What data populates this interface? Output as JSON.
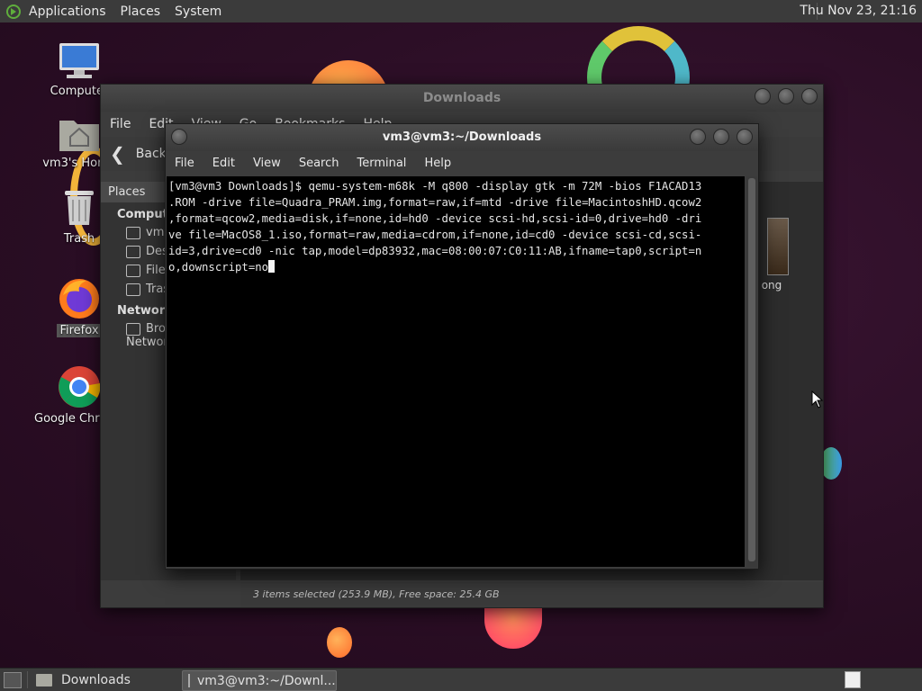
{
  "top_panel": {
    "menus": [
      "Applications",
      "Places",
      "System"
    ],
    "clock": "Thu Nov 23, 21:16"
  },
  "desktop_icons": [
    {
      "label": "Computer",
      "icon": "computer-icon"
    },
    {
      "label": "vm3's Home",
      "icon": "home-folder-icon"
    },
    {
      "label": "Trash",
      "icon": "trash-icon"
    },
    {
      "label": "Firefox",
      "icon": "firefox-icon"
    },
    {
      "label": "Google Chrome",
      "icon": "chrome-icon"
    }
  ],
  "file_manager": {
    "title": "Downloads",
    "menus": [
      "File",
      "Edit",
      "View",
      "Go",
      "Bookmarks",
      "Help"
    ],
    "back_label": "Back",
    "sidebar_header": "Places",
    "sections": {
      "computer": "Computer",
      "network": "Network"
    },
    "computer_items": [
      "vm3",
      "Desktop",
      "File System",
      "Trash"
    ],
    "network_items": [
      "Browse Network"
    ],
    "file_partial_label": "ong",
    "status": "3 items selected (253.9 MB), Free space: 25.4 GB"
  },
  "terminal": {
    "title": "vm3@vm3:~/Downloads",
    "menus": [
      "File",
      "Edit",
      "View",
      "Search",
      "Terminal",
      "Help"
    ],
    "lines": [
      "[vm3@vm3 Downloads]$ qemu-system-m68k -M q800 -display gtk -m 72M -bios F1ACAD13",
      ".ROM -drive file=Quadra_PRAM.img,format=raw,if=mtd -drive file=MacintoshHD.qcow2",
      ",format=qcow2,media=disk,if=none,id=hd0 -device scsi-hd,scsi-id=0,drive=hd0 -dri",
      "ve file=MacOS8_1.iso,format=raw,media=cdrom,if=none,id=cd0 -device scsi-cd,scsi-",
      "id=3,drive=cd0 -nic tap,model=dp83932,mac=08:00:07:C0:11:AB,ifname=tap0,script=n",
      "o,downscript=no"
    ]
  },
  "taskbar": {
    "items": [
      {
        "label": "Downloads",
        "icon": "folder-icon"
      },
      {
        "label": "vm3@vm3:~/Downl...",
        "icon": "terminal-icon"
      }
    ]
  }
}
